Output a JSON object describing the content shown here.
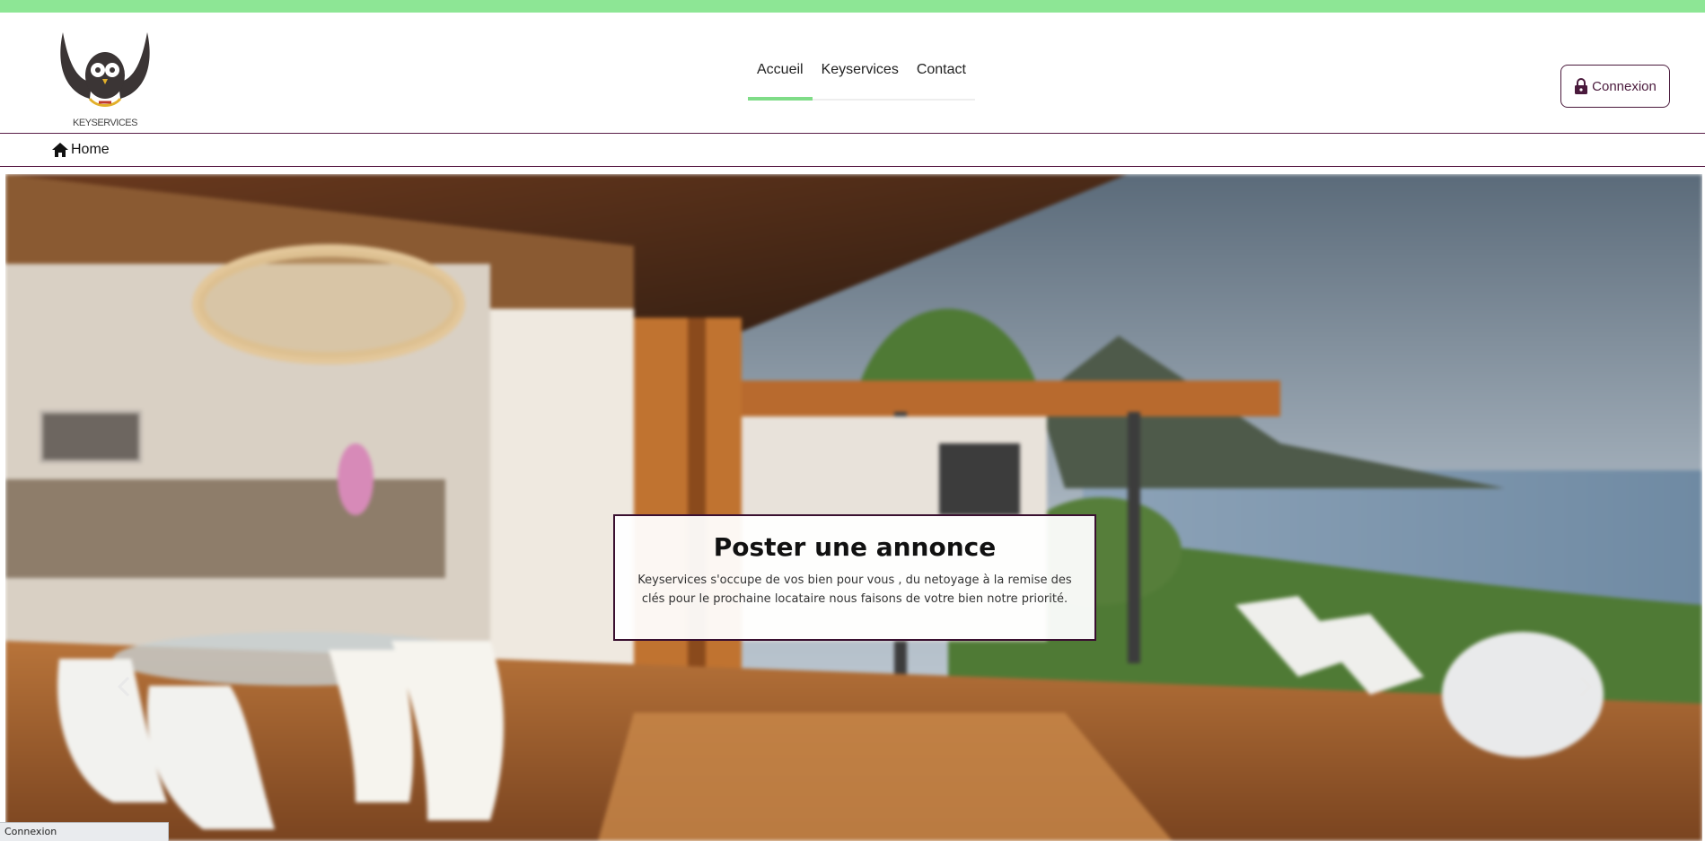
{
  "brand": {
    "logo_text": "KEYSERVICES",
    "accent": "#8de695",
    "primary": "#4a1a3c"
  },
  "nav": {
    "items": [
      {
        "label": "Accueil",
        "active": true
      },
      {
        "label": "Keyservices",
        "active": false
      },
      {
        "label": "Contact",
        "active": false
      }
    ]
  },
  "header": {
    "login_label": "Connexion",
    "login_icon": "lock-icon"
  },
  "breadcrumb": {
    "home_label": "Home",
    "home_icon": "home-icon"
  },
  "carousel": {
    "caption_title": "Poster une annonce",
    "caption_text": "Keyservices s'occupe de vos bien pour vous , du netoyage à la remise des clés pour le prochaine locataire nous faisons de votre bien notre priorité.",
    "prev_icon": "chevron-left-icon",
    "next_icon": "chevron-right-icon"
  },
  "status_bar": {
    "text": "Connexion"
  }
}
